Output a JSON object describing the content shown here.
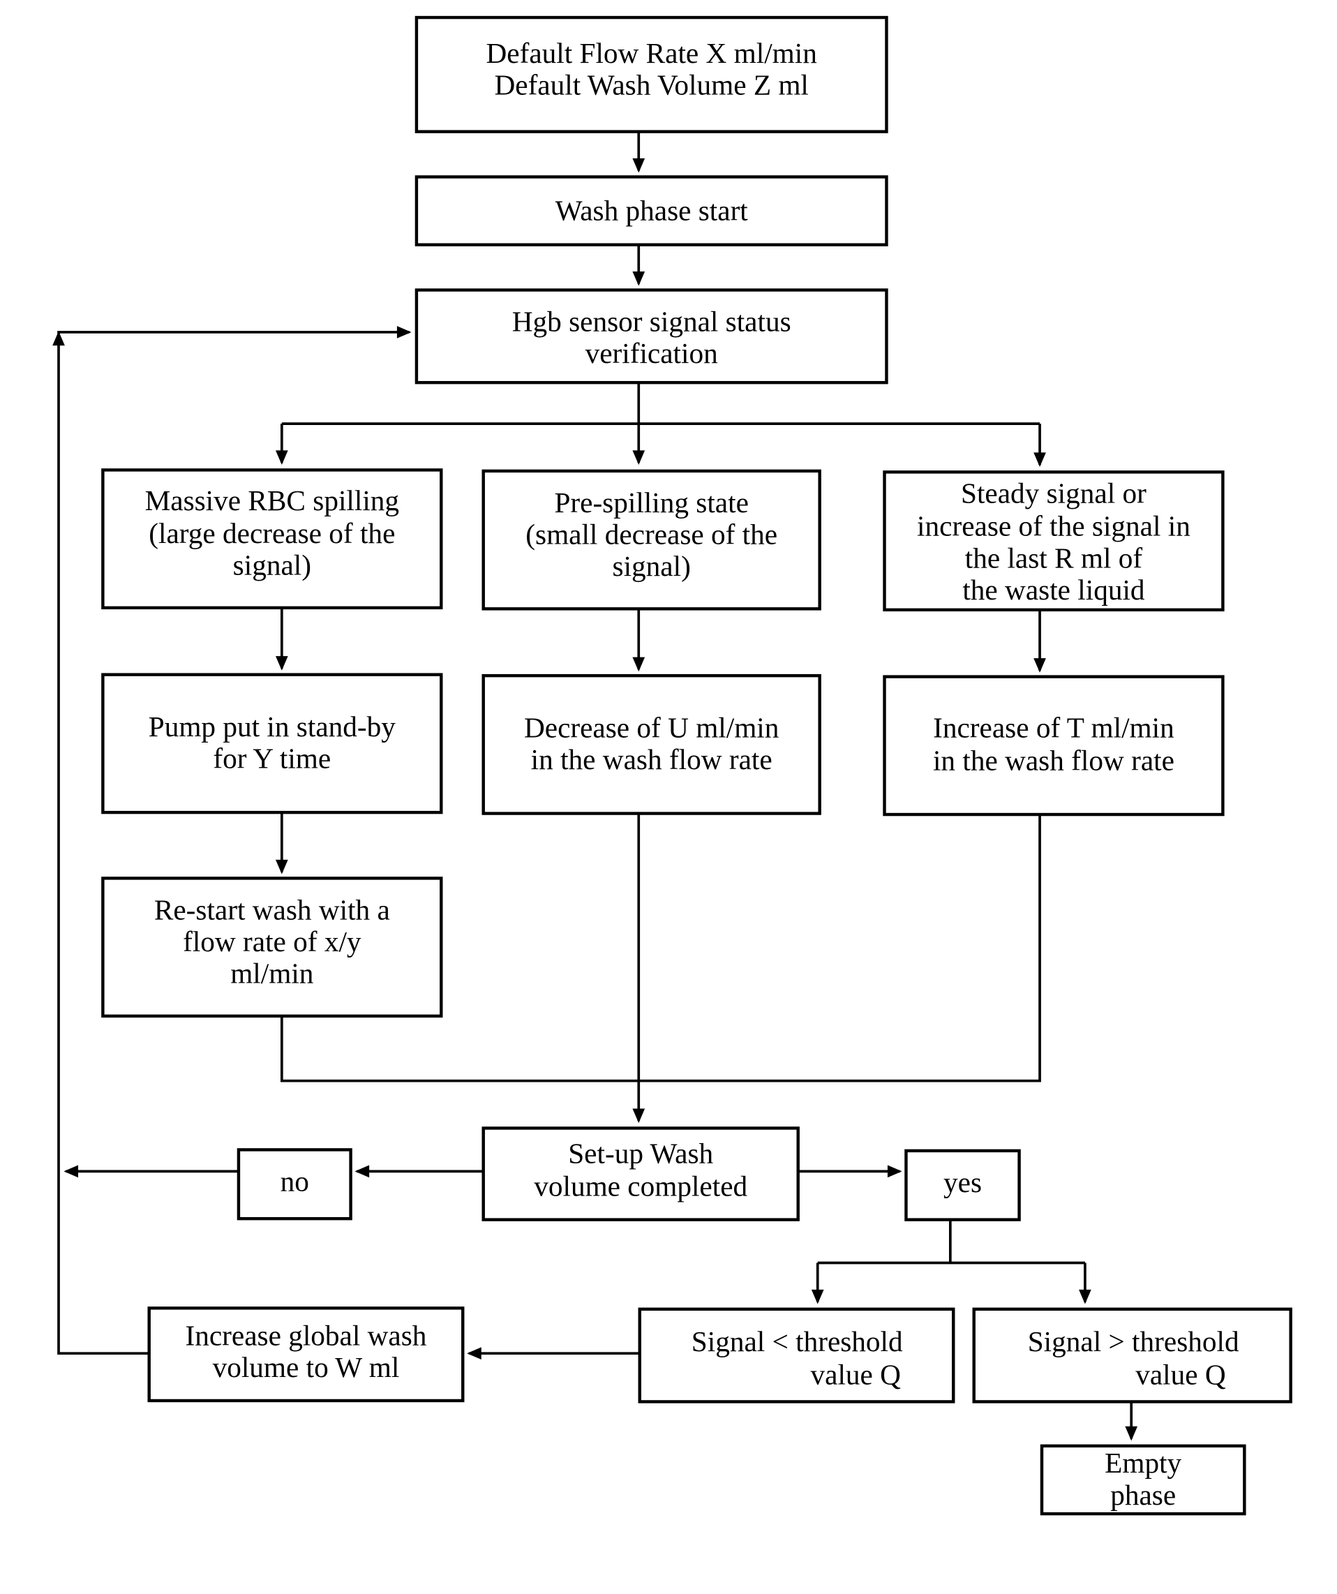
{
  "diagram": {
    "title": "",
    "colors": {
      "stroke": "#000000",
      "background": "#ffffff",
      "text": "#000000"
    },
    "nodes": {
      "defaults": {
        "lines": [
          "Default Flow Rate X ml/min",
          "Default Wash Volume Z ml"
        ]
      },
      "wash_start": {
        "lines": [
          "Wash phase start"
        ]
      },
      "hgb_check": {
        "lines": [
          "Hgb sensor signal status",
          "verification"
        ]
      },
      "massive_spill": {
        "lines": [
          "Massive RBC spilling",
          "(large decrease of the",
          "signal)"
        ]
      },
      "pre_spill": {
        "lines": [
          "Pre-spilling state",
          "(small decrease of the",
          "signal)"
        ]
      },
      "steady": {
        "lines": [
          "Steady signal or",
          "increase of the signal in",
          "the last R ml of",
          "the waste liquid"
        ]
      },
      "pump_standby": {
        "lines": [
          "Pump put in stand-by",
          "for Y time"
        ]
      },
      "decrease_rate": {
        "lines": [
          "Decrease of U ml/min",
          "in the wash flow rate"
        ]
      },
      "increase_rate": {
        "lines": [
          "Increase of T ml/min",
          "in the wash flow rate"
        ]
      },
      "restart_wash": {
        "lines": [
          "Re-start wash with a",
          "flow rate of x/y",
          "ml/min"
        ]
      },
      "setup_complete": {
        "lines": [
          "Set-up Wash",
          "volume completed"
        ]
      },
      "no": {
        "lines": [
          "no"
        ]
      },
      "yes": {
        "lines": [
          "yes"
        ]
      },
      "signal_below": {
        "lines": [
          "Signal < threshold",
          "value Q"
        ]
      },
      "signal_above": {
        "lines": [
          "Signal > threshold",
          "value Q"
        ]
      },
      "increase_volume": {
        "lines": [
          "Increase global wash",
          "volume to W ml"
        ]
      },
      "empty_phase": {
        "lines": [
          "Empty",
          "phase"
        ]
      }
    },
    "edges": [
      {
        "from": "defaults",
        "to": "wash_start"
      },
      {
        "from": "wash_start",
        "to": "hgb_check"
      },
      {
        "from": "hgb_check",
        "to": "massive_spill"
      },
      {
        "from": "hgb_check",
        "to": "pre_spill"
      },
      {
        "from": "hgb_check",
        "to": "steady"
      },
      {
        "from": "massive_spill",
        "to": "pump_standby"
      },
      {
        "from": "pre_spill",
        "to": "decrease_rate"
      },
      {
        "from": "steady",
        "to": "increase_rate"
      },
      {
        "from": "pump_standby",
        "to": "restart_wash"
      },
      {
        "from": "restart_wash",
        "to": "setup_complete"
      },
      {
        "from": "decrease_rate",
        "to": "setup_complete"
      },
      {
        "from": "increase_rate",
        "to": "setup_complete"
      },
      {
        "from": "setup_complete",
        "to": "no"
      },
      {
        "from": "setup_complete",
        "to": "yes"
      },
      {
        "from": "no",
        "to": "hgb_check"
      },
      {
        "from": "yes",
        "to": "signal_below"
      },
      {
        "from": "yes",
        "to": "signal_above"
      },
      {
        "from": "signal_below",
        "to": "increase_volume"
      },
      {
        "from": "increase_volume",
        "to": "hgb_check"
      },
      {
        "from": "signal_above",
        "to": "empty_phase"
      }
    ]
  }
}
